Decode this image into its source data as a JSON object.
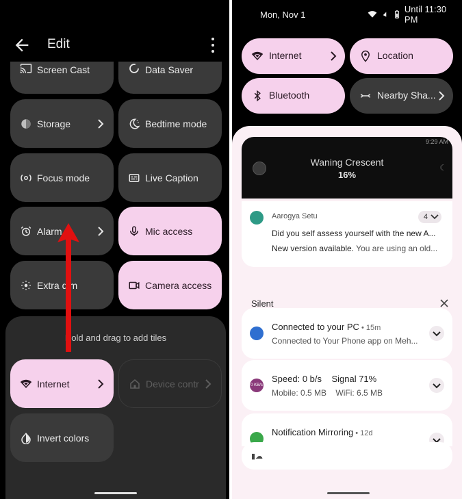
{
  "left": {
    "title": "Edit",
    "tiles": [
      {
        "label": "Screen Cast",
        "icon": "cast-icon"
      },
      {
        "label": "Data Saver",
        "icon": "data-saver-icon"
      },
      {
        "label": "Storage",
        "icon": "storage-icon"
      },
      {
        "label": "Bedtime mode",
        "icon": "bedtime-icon"
      },
      {
        "label": "Focus mode",
        "icon": "focus-icon"
      },
      {
        "label": "Live Caption",
        "icon": "caption-icon"
      },
      {
        "label": "Alarm",
        "icon": "alarm-icon"
      },
      {
        "label": "Mic access",
        "icon": "mic-icon"
      },
      {
        "label": "Extra dim",
        "icon": "extra-dim-icon"
      },
      {
        "label": "Camera access",
        "icon": "camera-icon"
      }
    ],
    "hint": "Hold and drag to add tiles",
    "available_tiles": [
      {
        "label": "Internet",
        "icon": "wifi-icon"
      },
      {
        "label": "Device contr",
        "icon": "home-icon"
      },
      {
        "label": "Invert colors",
        "icon": "invert-icon"
      }
    ]
  },
  "right": {
    "status": {
      "date": "Mon, Nov 1",
      "until": "Until 11:30 PM"
    },
    "quick_tiles": [
      {
        "label": "Internet",
        "icon": "wifi-icon"
      },
      {
        "label": "Location",
        "icon": "location-icon"
      },
      {
        "label": "Bluetooth",
        "icon": "bluetooth-icon"
      },
      {
        "label": "Nearby Sha...",
        "icon": "nearby-share-icon"
      }
    ],
    "media": {
      "time": "9:29 AM",
      "title": "Waning Crescent",
      "percent": "16%"
    },
    "aarogya": {
      "app": "Aarogya Setu",
      "count": "4",
      "line1": "Did you self assess yourself with the new A...",
      "line2_bold": "New version available.",
      "line2_rest": " You are using an old..."
    },
    "silent_label": "Silent",
    "notifications": [
      {
        "title": "Connected to your PC",
        "time": "15m",
        "subtitle": "Connected to Your Phone app on Meh..."
      },
      {
        "title": "Speed: 0 b/s    Signal 71%",
        "time": "",
        "subtitle": "Mobile: 0.5 MB    WiFi: 6.5 MB"
      },
      {
        "title": "Notification Mirroring",
        "time": "12d",
        "subtitle": ""
      }
    ],
    "speed_icon_text": "0 KB/s"
  }
}
